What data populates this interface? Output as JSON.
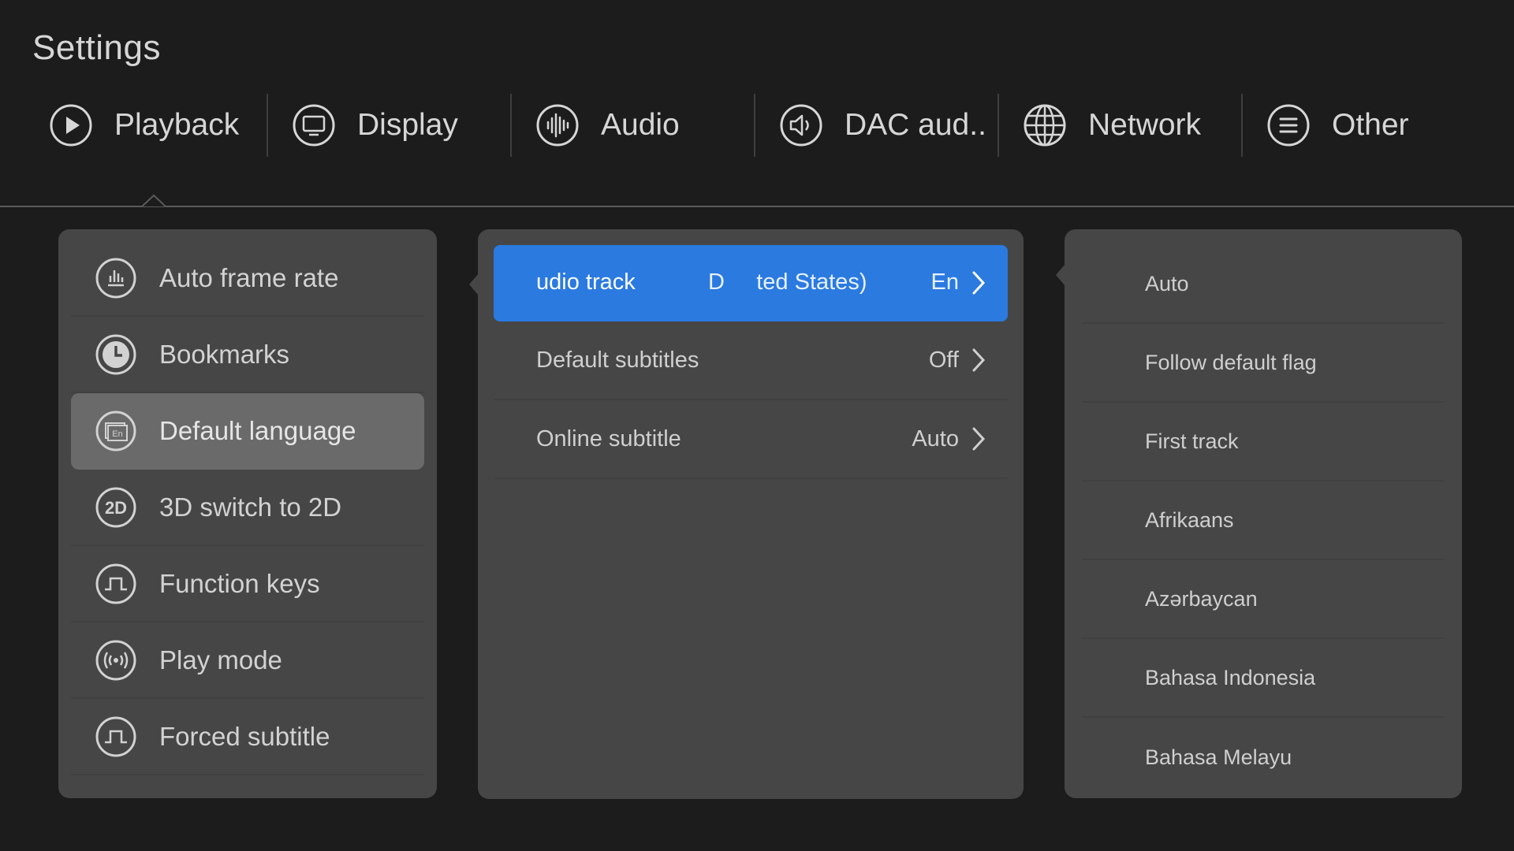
{
  "page_title": "Settings",
  "tabs": [
    {
      "label": "Playback",
      "icon": "play-icon"
    },
    {
      "label": "Display",
      "icon": "monitor-icon"
    },
    {
      "label": "Audio",
      "icon": "audio-wave-icon"
    },
    {
      "label": "DAC aud..",
      "icon": "speaker-icon"
    },
    {
      "label": "Network",
      "icon": "globe-icon"
    },
    {
      "label": "Other",
      "icon": "menu-icon"
    }
  ],
  "left_menu": [
    {
      "label": "Auto frame rate",
      "icon": "bar-chart-icon"
    },
    {
      "label": "Bookmarks",
      "icon": "clock-icon"
    },
    {
      "label": "Default language",
      "icon": "language-icon"
    },
    {
      "label": "3D switch to 2D",
      "icon": "2d-icon"
    },
    {
      "label": "Function keys",
      "icon": "pulse-icon"
    },
    {
      "label": "Play mode",
      "icon": "broadcast-icon"
    },
    {
      "label": "Forced subtitle",
      "icon": "pulse-icon"
    }
  ],
  "middle_menu": {
    "audio_track": {
      "label": "udio track",
      "value_a": "D     ted States)",
      "value_b": "En"
    },
    "default_subtitles": {
      "label": "Default subtitles",
      "value": "Off"
    },
    "online_subtitle": {
      "label": "Online subtitle",
      "value": "Auto"
    }
  },
  "right_options": [
    "Auto",
    "Follow default flag",
    "First track",
    "Afrikaans",
    "Azərbaycan",
    "Bahasa Indonesia",
    "Bahasa Melayu"
  ],
  "colors": {
    "background": "#1c1c1c",
    "panel": "#464646",
    "selected_item": "#6a6a6a",
    "focus_highlight": "#2a7ae0"
  }
}
